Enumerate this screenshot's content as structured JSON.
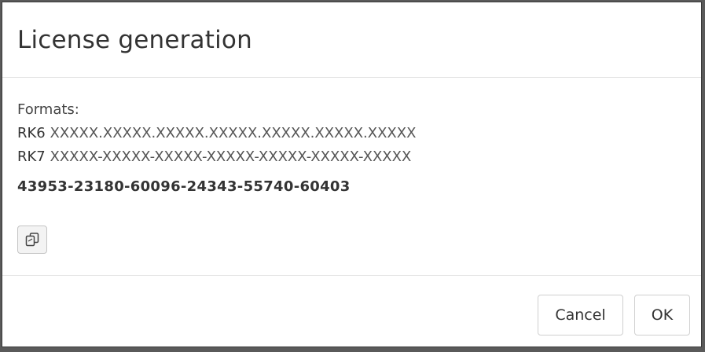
{
  "dialog": {
    "title": "License generation",
    "formats_label": "Formats:",
    "formats": [
      {
        "prefix": "RK6",
        "pattern": "XXXXX.XXXXX.XXXXX.XXXXX.XXXXX.XXXXX.XXXXX"
      },
      {
        "prefix": "RK7",
        "pattern": "XXXXX-XXXXX-XXXXX-XXXXX-XXXXX-XXXXX-XXXXX"
      }
    ],
    "license_key": "43953-23180-60096-24343-55740-60403",
    "copy_icon": "copy-icon",
    "cancel_label": "Cancel",
    "ok_label": "OK"
  }
}
